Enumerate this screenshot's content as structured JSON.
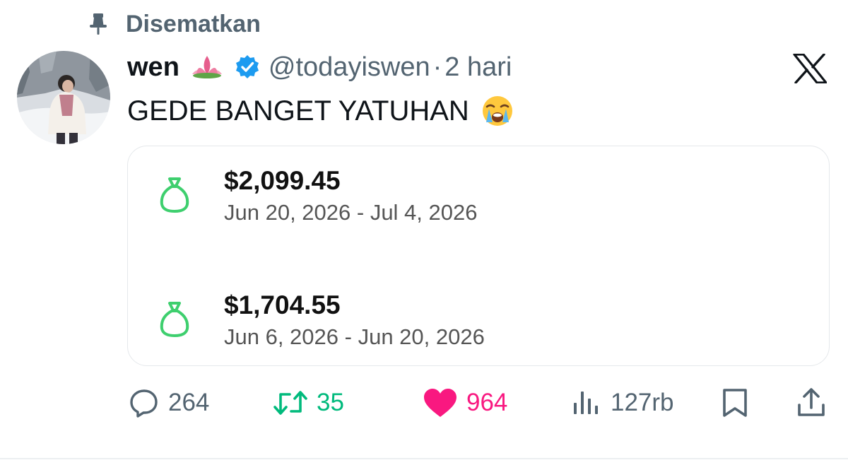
{
  "pinned": {
    "label": "Disematkan"
  },
  "author": {
    "name": "wen",
    "name_emoji": "lotus-emoji",
    "verified": true,
    "handle": "@todayiswen",
    "separator": "·",
    "time": "2 hari"
  },
  "tweet": {
    "text": "GEDE BANGET YATUHAN",
    "emoji": "loudly-crying-face-emoji"
  },
  "payouts": [
    {
      "amount": "$2,099.45",
      "dates": "Jun 20, 2026 - Jul 4, 2026"
    },
    {
      "amount": "$1,704.55",
      "dates": "Jun 6, 2026 - Jun 20, 2026"
    }
  ],
  "actions": {
    "replies": "264",
    "retweets": "35",
    "likes": "964",
    "views": "127rb"
  },
  "colors": {
    "secondary_text": "#536471",
    "verified_blue": "#1d9bf0",
    "retweet_green": "#00ba7c",
    "like_pink": "#f91880",
    "money_green": "#3ecf6e"
  }
}
